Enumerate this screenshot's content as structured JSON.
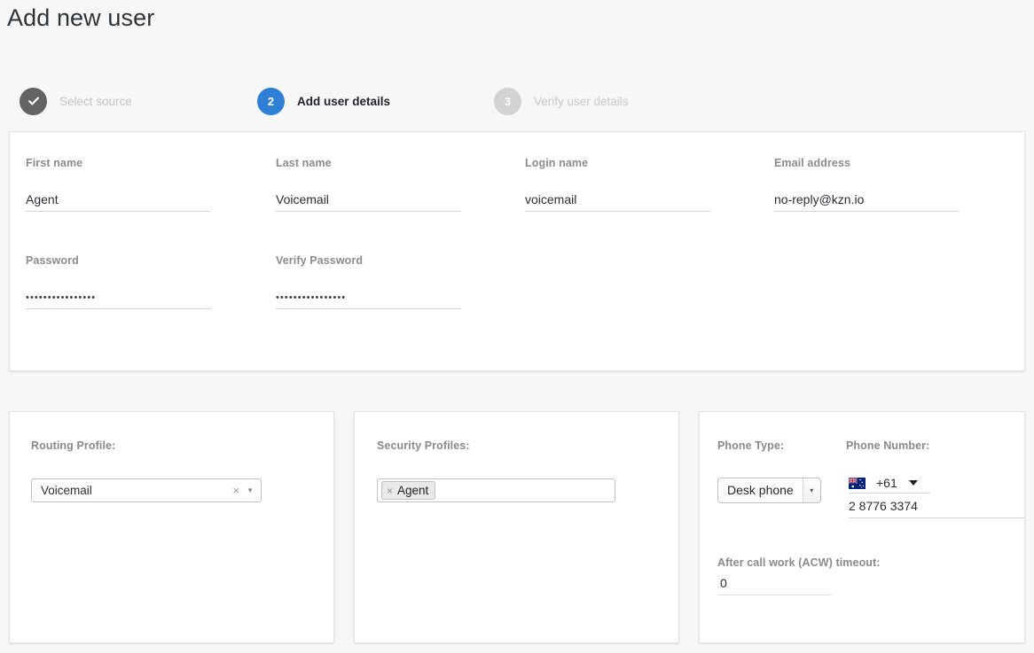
{
  "page": {
    "title": "Add new user",
    "accent_color": "#2d80d6",
    "done_color": "#636363",
    "todo_color": "#d2d2d2",
    "background": "#f7f7f7"
  },
  "wizard": {
    "steps": [
      {
        "number": "",
        "label": "Select source",
        "state": "done",
        "icon": "check-icon"
      },
      {
        "number": "2",
        "label": "Add user details",
        "state": "active"
      },
      {
        "number": "3",
        "label": "Verify user details",
        "state": "todo"
      }
    ]
  },
  "details": {
    "fields": [
      {
        "label": "First name",
        "value": "Agent",
        "placeholder": ""
      },
      {
        "label": "Last name",
        "value": "Voicemail",
        "placeholder": ""
      },
      {
        "label": "Login name",
        "value": "voicemail",
        "placeholder": ""
      },
      {
        "label": "Email address",
        "value": "no-reply@kzn.io",
        "placeholder": ""
      },
      {
        "label": "Password",
        "value": "••••••••••••••••",
        "placeholder": ""
      },
      {
        "label": "Verify Password",
        "value": "••••••••••••••••",
        "placeholder": ""
      }
    ]
  },
  "routing": {
    "label": "Routing Profile:",
    "selected": "Voicemail",
    "clear_glyph": "×",
    "caret_glyph": "▼"
  },
  "security": {
    "label": "Security Profiles:",
    "tags": [
      {
        "label": "Agent",
        "remove_glyph": "×"
      }
    ]
  },
  "phone": {
    "type_label": "Phone Type:",
    "type_value": "Desk phone",
    "type_caret": "▾",
    "number_label": "Phone Number:",
    "country_flag": "australia-flag-icon",
    "dial_code": "+61",
    "number_value": "2 8776 3374",
    "number_placeholder": ""
  },
  "acw": {
    "label": "After call work (ACW) timeout:",
    "value": "0",
    "placeholder": ""
  }
}
